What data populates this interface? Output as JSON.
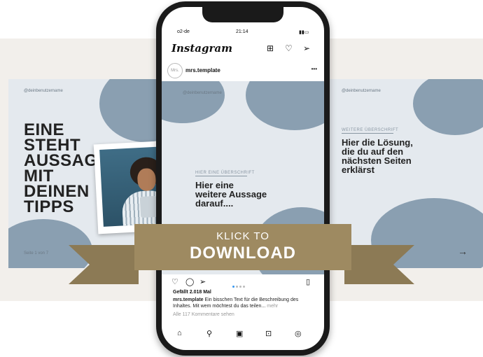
{
  "slides": {
    "left": {
      "handle": "@deinbenutzername",
      "headline": [
        "EINE",
        "STEHT",
        "AUSSAGE",
        "MIT",
        "DEINEN",
        "TIPPS"
      ],
      "page_count": "Seite 1 von 7"
    },
    "center": {
      "handle": "@deinbenutzername",
      "subheading": "HIER EINE ÜBERSCHRIFT",
      "headline": [
        "Hier eine",
        "weitere Aussage",
        "darauf...."
      ]
    },
    "right": {
      "handle": "@deinbenutzername",
      "subheading": "WEITERE ÜBERSCHRIFT",
      "headline": [
        "Hier die Lösung,",
        "die du auf den",
        "nächsten Seiten",
        "erklärst"
      ]
    }
  },
  "phone": {
    "status": {
      "carrier": "o2-de",
      "time": "21:14"
    },
    "app": "Instagram",
    "post": {
      "username": "mrs.template",
      "avatar_text": "Mrs.",
      "likes": "Gefällt 2.018 Mal",
      "caption_user": "mrs.template",
      "caption_text": "Ein bisschen Text für die Beschreibung des Inhaltes. Mit wem möchtest du das teilen...",
      "caption_more": "mehr",
      "comments": "Alle 117 Kommentare sehen"
    }
  },
  "cta": {
    "line1": "KLICK TO",
    "line2": "DOWNLOAD"
  },
  "colors": {
    "ribbon": "#9e8a61",
    "slide_bg": "#e4e9ee",
    "blob": "#8a9fb1",
    "page_bg": "#f2efeb"
  }
}
